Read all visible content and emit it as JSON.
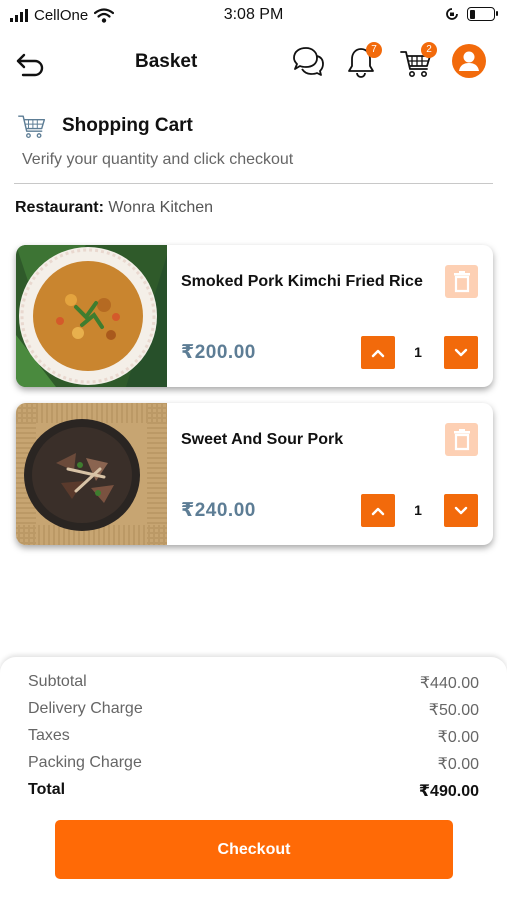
{
  "status_bar": {
    "carrier": "CellOne",
    "time": "3:08 PM"
  },
  "header": {
    "title": "Basket",
    "notification_count": "7",
    "cart_count": "2"
  },
  "cart": {
    "title": "Shopping Cart",
    "subtitle": "Verify your quantity and click checkout",
    "restaurant_label": "Restaurant:",
    "restaurant_name": "Wonra Kitchen"
  },
  "items": [
    {
      "name": "Smoked Pork Kimchi Fried Rice",
      "price": "₹200.00",
      "quantity": "1"
    },
    {
      "name": "Sweet And Sour Pork",
      "price": "₹240.00",
      "quantity": "1"
    }
  ],
  "summary": {
    "subtotal_label": "Subtotal",
    "subtotal": "₹440.00",
    "delivery_label": "Delivery Charge",
    "delivery": "₹50.00",
    "taxes_label": "Taxes",
    "taxes": "₹0.00",
    "packing_label": "Packing Charge",
    "packing": "₹0.00",
    "total_label": "Total",
    "total": "₹490.00"
  },
  "checkout_label": "Checkout",
  "colors": {
    "accent": "#f26a0b",
    "price": "#5d7d95",
    "delete_bg": "#fdd0b4"
  }
}
